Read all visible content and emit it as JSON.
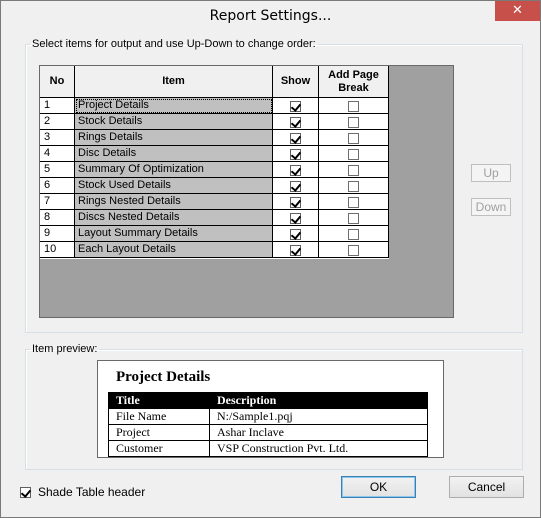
{
  "window": {
    "title": "Report Settings...",
    "close_glyph": "✕"
  },
  "items_group": {
    "legend": "Select items for output and use Up-Down to change order:",
    "headers": {
      "no": "No",
      "item": "Item",
      "show": "Show",
      "page_break": "Add Page Break"
    },
    "rows": [
      {
        "no": "1",
        "item": "Project Details",
        "show": true,
        "page_break": false
      },
      {
        "no": "2",
        "item": "Stock Details",
        "show": true,
        "page_break": false
      },
      {
        "no": "3",
        "item": "Rings Details",
        "show": true,
        "page_break": false
      },
      {
        "no": "4",
        "item": "Disc Details",
        "show": true,
        "page_break": false
      },
      {
        "no": "5",
        "item": "Summary Of Optimization",
        "show": true,
        "page_break": false
      },
      {
        "no": "6",
        "item": "Stock Used Details",
        "show": true,
        "page_break": false
      },
      {
        "no": "7",
        "item": "Rings Nested Details",
        "show": true,
        "page_break": false
      },
      {
        "no": "8",
        "item": "Discs Nested Details",
        "show": true,
        "page_break": false
      },
      {
        "no": "9",
        "item": "Layout Summary Details",
        "show": true,
        "page_break": false
      },
      {
        "no": "10",
        "item": "Each Layout Details",
        "show": true,
        "page_break": false
      }
    ],
    "up_label": "Up",
    "down_label": "Down"
  },
  "preview_group": {
    "legend": "Item preview:",
    "title": "Project Details",
    "headers": [
      "Title",
      "Description"
    ],
    "rows": [
      [
        "File Name",
        "N:/Sample1.pqj"
      ],
      [
        "Project",
        "Ashar Inclave"
      ],
      [
        "Customer",
        "VSP Construction Pvt. Ltd."
      ]
    ]
  },
  "footer": {
    "shade_label": "Shade Table header",
    "shade_checked": true,
    "ok_label": "OK",
    "cancel_label": "Cancel"
  },
  "colors": {
    "item_cell": "#c0c0c0",
    "grid_background": "#a0a0a0",
    "close_button": "#c7504b"
  }
}
